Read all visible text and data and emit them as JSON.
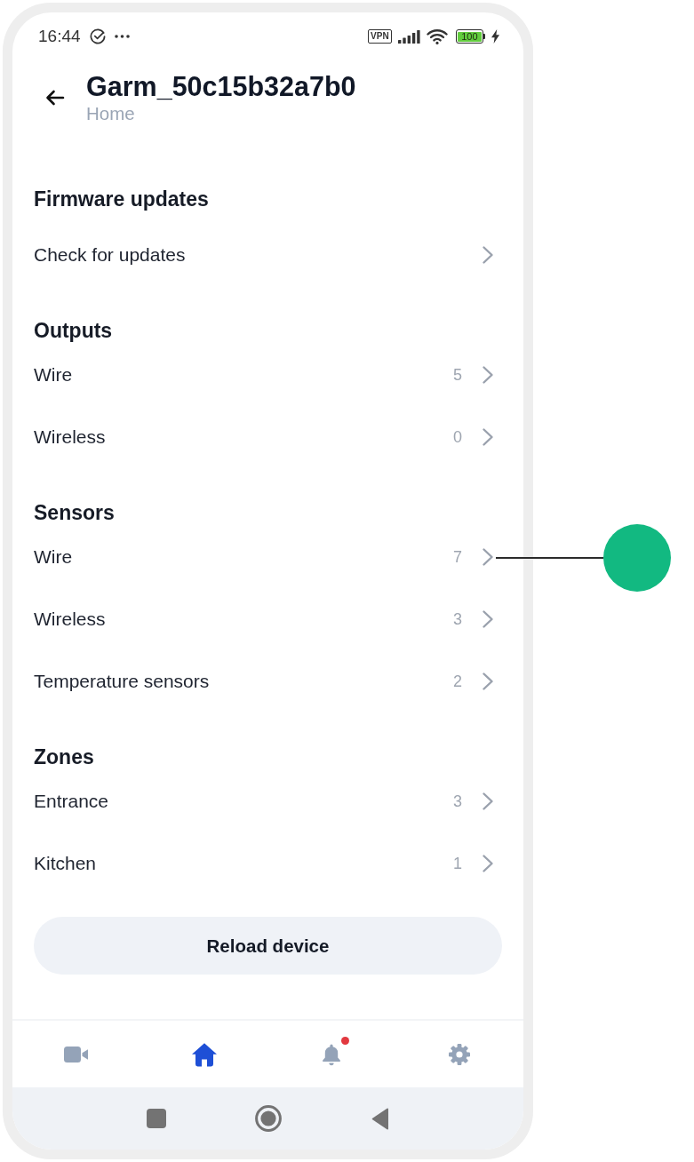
{
  "status_bar": {
    "time": "16:44",
    "vpn_label": "VPN",
    "battery": "100"
  },
  "header": {
    "title": "Garm_50c15b32a7b0",
    "subtitle": "Home"
  },
  "sections": [
    {
      "title": "Firmware updates",
      "items": [
        {
          "label": "Check for updates"
        }
      ]
    },
    {
      "title": "Outputs",
      "items": [
        {
          "label": "Wire",
          "count": "5"
        },
        {
          "label": "Wireless",
          "count": "0"
        }
      ]
    },
    {
      "title": "Sensors",
      "items": [
        {
          "label": "Wire",
          "count": "7"
        },
        {
          "label": "Wireless",
          "count": "3"
        },
        {
          "label": "Temperature sensors",
          "count": "2"
        }
      ]
    },
    {
      "title": "Zones",
      "items": [
        {
          "label": "Entrance",
          "count": "3"
        },
        {
          "label": "Kitchen",
          "count": "1"
        }
      ]
    }
  ],
  "reload_button": {
    "label": "Reload device"
  },
  "bottom_nav": [
    {
      "kind": "video",
      "selected": false,
      "badge": false
    },
    {
      "kind": "home",
      "selected": true,
      "badge": false
    },
    {
      "kind": "bell",
      "selected": false,
      "badge": true
    },
    {
      "kind": "gear",
      "selected": false,
      "badge": false
    }
  ]
}
